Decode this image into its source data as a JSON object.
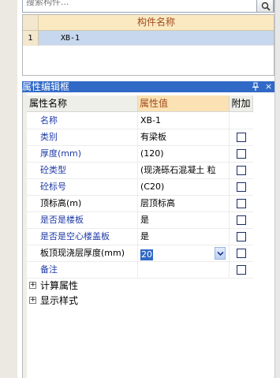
{
  "search": {
    "placeholder": "搜索构件..."
  },
  "components": {
    "header": "构件名称",
    "rows": [
      {
        "index": "1",
        "name": "XB-1"
      }
    ]
  },
  "property_panel": {
    "title": "属性编辑框",
    "pin_icon": "pin-icon",
    "close_glyph": "×",
    "columns": {
      "name": "属性名称",
      "value": "属性值",
      "append": "附加"
    },
    "rows": [
      {
        "name": "名称",
        "value": "XB-1",
        "color": "blue",
        "checkbox": false
      },
      {
        "name": "类别",
        "value": "有梁板",
        "color": "blue",
        "checkbox": true
      },
      {
        "name": "厚度(mm)",
        "value": "(120)",
        "color": "blue",
        "checkbox": true
      },
      {
        "name": "砼类型",
        "value": "(现浇砾石混凝土 粒",
        "color": "blue",
        "checkbox": true
      },
      {
        "name": "砼标号",
        "value": "(C20)",
        "color": "blue",
        "checkbox": true
      },
      {
        "name": "顶标高(m)",
        "value": "层顶标高",
        "color": "black",
        "checkbox": true
      },
      {
        "name": "是否是楼板",
        "value": "是",
        "color": "blue",
        "checkbox": true
      },
      {
        "name": "是否是空心楼盖板",
        "value": "是",
        "color": "blue",
        "checkbox": true
      },
      {
        "name": "板顶现浇层厚度(mm)",
        "value": "20",
        "color": "black",
        "checkbox": true
      },
      {
        "name": "备注",
        "value": "",
        "color": "blue",
        "checkbox": true
      }
    ],
    "groups": [
      "计算属性",
      "显示样式"
    ]
  },
  "colors": {
    "title_bar": "#3169c6",
    "header_value_bg": "#fbe2b4",
    "selected_row": "#c6d7ee",
    "blue_text": "#1f3ba6"
  }
}
